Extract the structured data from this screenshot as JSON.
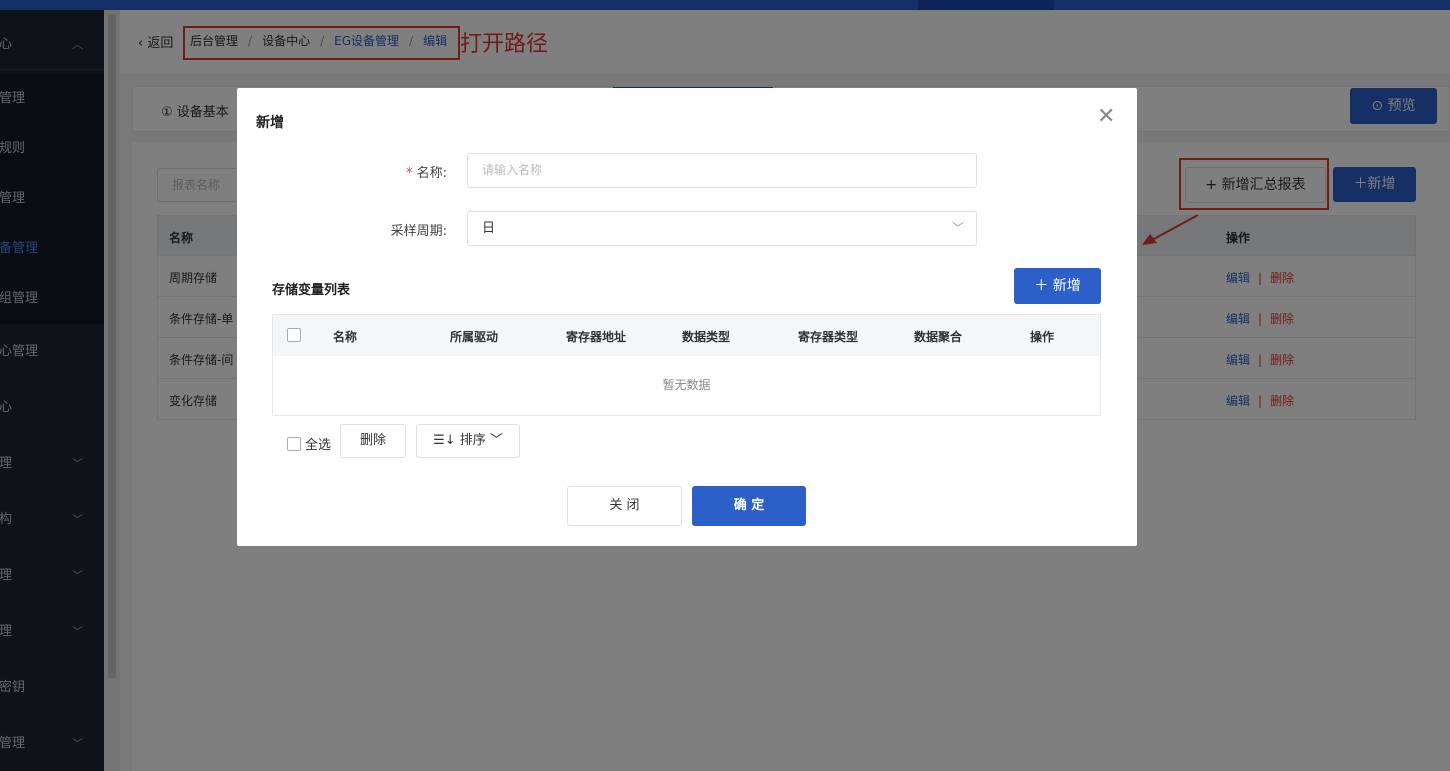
{
  "breadcrumb": {
    "back_label": "返回",
    "items": [
      "后台管理",
      "设备中心",
      "EG设备管理",
      "编辑"
    ],
    "annotation": "打开路径"
  },
  "sidebar": {
    "items": [
      {
        "label": "心",
        "expandable": true
      },
      {
        "label": "管理"
      },
      {
        "label": "规则"
      },
      {
        "label": "管理"
      },
      {
        "label": "备管理",
        "active": true
      },
      {
        "label": "组管理"
      },
      {
        "label": "心管理"
      },
      {
        "label": "心"
      },
      {
        "label": "理",
        "expandable": true
      },
      {
        "label": "构",
        "expandable": true
      },
      {
        "label": "理",
        "expandable": true
      },
      {
        "label": "理",
        "expandable": true
      },
      {
        "label": "密钥"
      },
      {
        "label": "管理",
        "expandable": true
      }
    ]
  },
  "page": {
    "tab1_label": "① 设备基本",
    "preview_label": "预览",
    "report_name_placeholder": "报表名称",
    "add_summary_label": "+ 新增汇总报表",
    "add_label": "新增",
    "table": {
      "headers": [
        "名称",
        "操作"
      ],
      "rows": [
        {
          "name": "周期存储",
          "edit": "编辑",
          "delete": "删除"
        },
        {
          "name": "条件存储-单",
          "edit": "编辑",
          "delete": "删除"
        },
        {
          "name": "条件存储-间",
          "edit": "编辑",
          "delete": "删除"
        },
        {
          "name": "变化存储",
          "edit": "编辑",
          "delete": "删除"
        }
      ]
    }
  },
  "dialog": {
    "title": "新增",
    "name_label": "名称:",
    "name_placeholder": "请输入名称",
    "period_label": "采样周期:",
    "period_value": "日",
    "list_title": "存储变量列表",
    "list_add_label": "新增",
    "columns": [
      "名称",
      "所属驱动",
      "寄存器地址",
      "数据类型",
      "寄存器类型",
      "数据聚合",
      "操作"
    ],
    "empty_text": "暂无数据",
    "select_all_label": "全选",
    "delete_label": "删除",
    "sort_label": "排序",
    "close_label": "关 闭",
    "confirm_label": "确 定"
  },
  "colors": {
    "primary": "#2d5fc9",
    "danger": "#e53935",
    "sidebar_bg": "#1e2531"
  }
}
